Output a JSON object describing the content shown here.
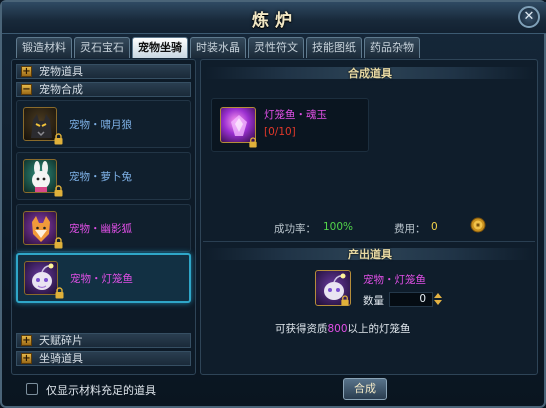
{
  "window": {
    "title": "炼炉",
    "close_icon": "close-icon"
  },
  "tabs": [
    {
      "label": "锻造材料",
      "active": false
    },
    {
      "label": "灵石宝石",
      "active": false
    },
    {
      "label": "宠物坐骑",
      "active": true
    },
    {
      "label": "时装水晶",
      "active": false
    },
    {
      "label": "灵性符文",
      "active": false
    },
    {
      "label": "技能图纸",
      "active": false
    },
    {
      "label": "药品杂物",
      "active": false
    }
  ],
  "left": {
    "categories": {
      "pet_items": {
        "label": "宠物道具",
        "expander": "+"
      },
      "pet_synthesis": {
        "label": "宠物合成",
        "expander": "−"
      },
      "talent_fragments": {
        "label": "天赋碎片",
        "expander": "+"
      },
      "mount_items": {
        "label": "坐骑道具",
        "expander": "+"
      }
    },
    "pets": [
      {
        "name": "宠物・啸月狼",
        "color": "#7fb2e8",
        "icon": "wolf-icon",
        "selected": false
      },
      {
        "name": "宠物・萝卜兔",
        "color": "#7fb2e8",
        "icon": "rabbit-icon",
        "selected": false
      },
      {
        "name": "宠物・幽影狐",
        "color": "#e04fe6",
        "icon": "fox-icon",
        "selected": false
      },
      {
        "name": "宠物・灯笼鱼",
        "color": "#e04fe6",
        "icon": "lantern-fish-icon",
        "selected": true
      }
    ]
  },
  "synthesis": {
    "header": "合成道具",
    "material": {
      "name": "灯笼鱼・魂玉",
      "count": "[0/10]",
      "name_color": "#e04fe6",
      "count_color": "#e0382a",
      "icon": "soul-jade-icon"
    },
    "success_label": "成功率：",
    "success_value": "100%",
    "cost_label": "费用：",
    "cost_value": "0",
    "coin_icon": "gold-coin-icon"
  },
  "output": {
    "header": "产出道具",
    "item_name": "宠物・灯笼鱼",
    "item_color": "#e04fe6",
    "item_icon": "lantern-fish-icon",
    "qty_label": "数量",
    "qty_value": "0",
    "desc_prefix": "可获得资质",
    "desc_value": "800",
    "desc_suffix": "以上的灯笼鱼"
  },
  "bottom": {
    "checkbox_label": "仅显示材料充足的道具",
    "checkbox_checked": false,
    "synth_button": "合成"
  }
}
